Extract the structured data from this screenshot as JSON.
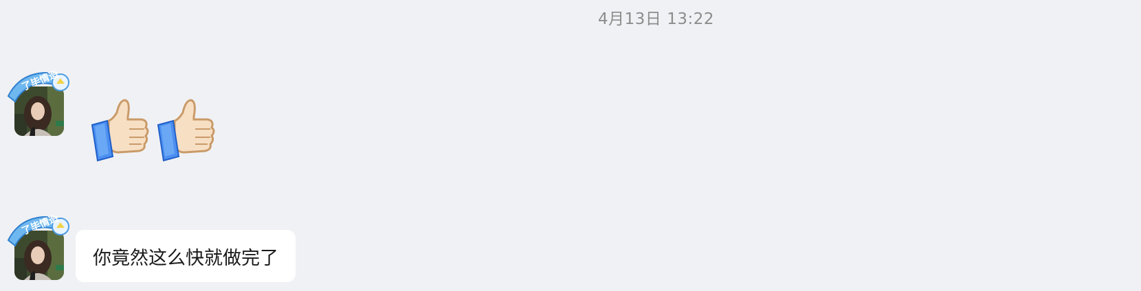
{
  "chat": {
    "timestamp": "4月13日 13:22",
    "messages": [
      {
        "type": "emoji",
        "sender": "contact",
        "emojis": [
          "thumbs-up",
          "thumbs-up"
        ],
        "avatar_badge_text": "了毕情造"
      },
      {
        "type": "text",
        "sender": "contact",
        "text": "你竟然这么快就做完了",
        "avatar_badge_text": "了毕情造"
      }
    ]
  },
  "colors": {
    "background": "#f0f1f4",
    "bubble": "#ffffff",
    "timestamp": "#8c8c8c",
    "badge": "#4a9be3"
  }
}
